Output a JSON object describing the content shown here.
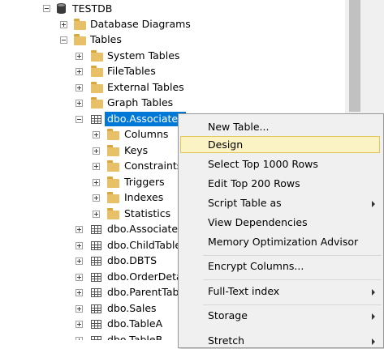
{
  "tree": {
    "database": "TESTDB",
    "database_children": [
      "Database Diagrams",
      "Tables"
    ],
    "tables_children": [
      "System Tables",
      "FileTables",
      "External Tables",
      "Graph Tables"
    ],
    "selected_table": "dbo.Associates",
    "selected_table_children": [
      "Columns",
      "Keys",
      "Constraints",
      "Triggers",
      "Indexes",
      "Statistics"
    ],
    "other_tables": [
      "dbo.Associates",
      "dbo.ChildTable",
      "dbo.DBTS",
      "dbo.OrderDeta",
      "dbo.ParentTab",
      "dbo.Sales",
      "dbo.TableA",
      "dbo.TableB"
    ]
  },
  "context_menu": {
    "items": [
      {
        "label": "New Table..."
      },
      {
        "label": "Design",
        "highlighted": true
      },
      {
        "label": "Select Top 1000 Rows"
      },
      {
        "label": "Edit Top 200 Rows"
      },
      {
        "label": "Script Table as",
        "submenu": true
      },
      {
        "label": "View Dependencies"
      },
      {
        "label": "Memory Optimization Advisor"
      },
      {
        "label": "Encrypt Columns..."
      },
      {
        "label": "Full-Text index",
        "submenu": true
      },
      {
        "label": "Storage",
        "submenu": true
      },
      {
        "label": "Stretch",
        "submenu": true
      }
    ]
  },
  "colors": {
    "selection": "#0078d7",
    "menu_highlight": "#fcf3c4",
    "menu_highlight_border": "#e3c65a",
    "folder": "#e8c067"
  }
}
